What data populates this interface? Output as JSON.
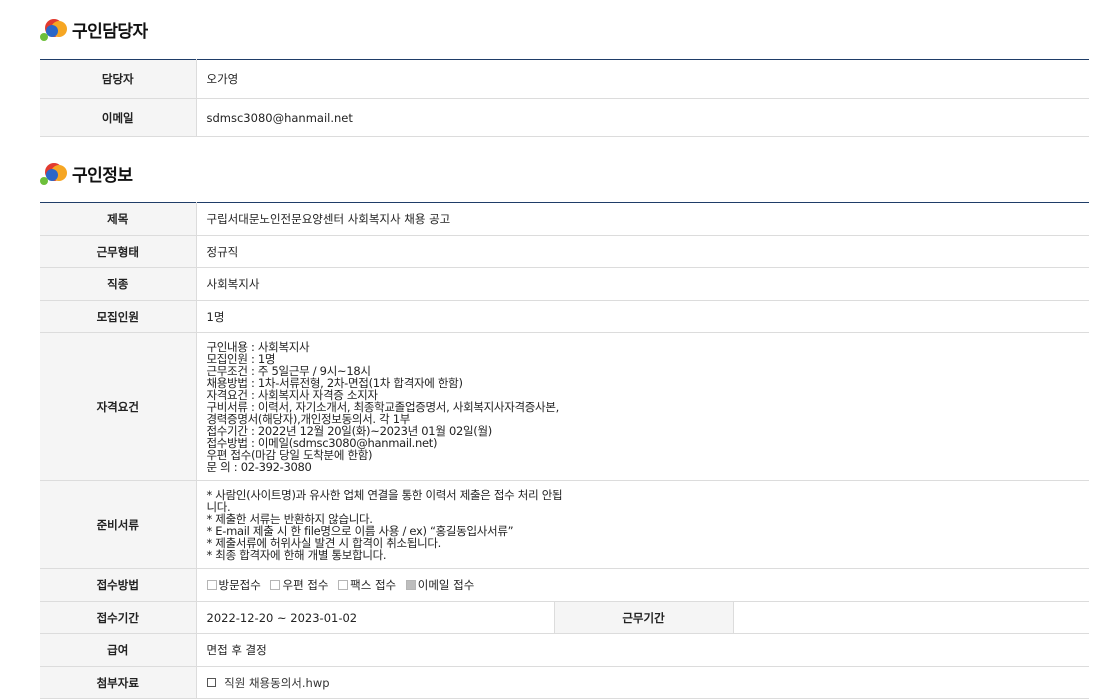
{
  "contact_section": {
    "title": "구인담당자",
    "rows": [
      {
        "label": "담당자",
        "value": "오가영"
      },
      {
        "label": "이메일",
        "value": "sdmsc3080@hanmail.net"
      }
    ]
  },
  "job_section": {
    "title": "구인정보",
    "title_row": {
      "label": "제목",
      "value": "구립서대문노인전문요양센터 사회복지사 채용 공고"
    },
    "work_type": {
      "label": "근무형태",
      "value": "정규직"
    },
    "job_kind": {
      "label": "직종",
      "value": "사회복지사"
    },
    "headcount": {
      "label": "모집인원",
      "value": "1명"
    },
    "requirements": {
      "label": "자격요건",
      "value": "구인내용 : 사회복지사\n모집인원 : 1명\n근무조건 : 주 5일근무 / 9시~18시\n채용방법 : 1차-서류전형, 2차-면접(1차 합격자에 한함)\n자격요건 : 사회복지사 자격증 소지자\n구비서류 : 이력서, 자기소개서, 최종학교졸업증명서, 사회복지사자격증사본,\n경력증명서(해당자),개인정보동의서. 각 1부\n접수기간 : 2022년 12월 20일(화)~2023년 01월 02일(월)\n접수방법 : 이메일(sdmsc3080@hanmail.net)\n우편 접수(마감 당일 도착분에 한함)\n문 의 : 02-392-3080"
    },
    "documents": {
      "label": "준비서류",
      "value": "* 사람인(사이트명)과 유사한 업체 연결을 통한 이력서 제출은 접수 처리 안됩\n니다.\n* 제출한 서류는 반환하지 않습니다.\n* E-mail 제출 시 한 file명으로 이름 사용 / ex) “홍길동입사서류”\n* 제출서류에 허위사실 발견 시 합격이 취소됩니다.\n* 최종 합격자에 한해 개별 통보합니다."
    },
    "apply_method": {
      "label": "접수방법",
      "options": [
        {
          "label": "방문접수",
          "checked": false
        },
        {
          "label": "우편 접수",
          "checked": false
        },
        {
          "label": "팩스 접수",
          "checked": false
        },
        {
          "label": "이메일 접수",
          "checked": true
        }
      ]
    },
    "apply_period": {
      "label": "접수기간",
      "value": "2022-12-20 ~ 2023-01-02"
    },
    "work_period": {
      "label": "근무기간",
      "value": ""
    },
    "salary": {
      "label": "급여",
      "value": "면접 후 결정"
    },
    "attachment": {
      "label": "첨부자료",
      "file_icon": "file-icon",
      "value": "직원 채용동의서.hwp"
    }
  }
}
